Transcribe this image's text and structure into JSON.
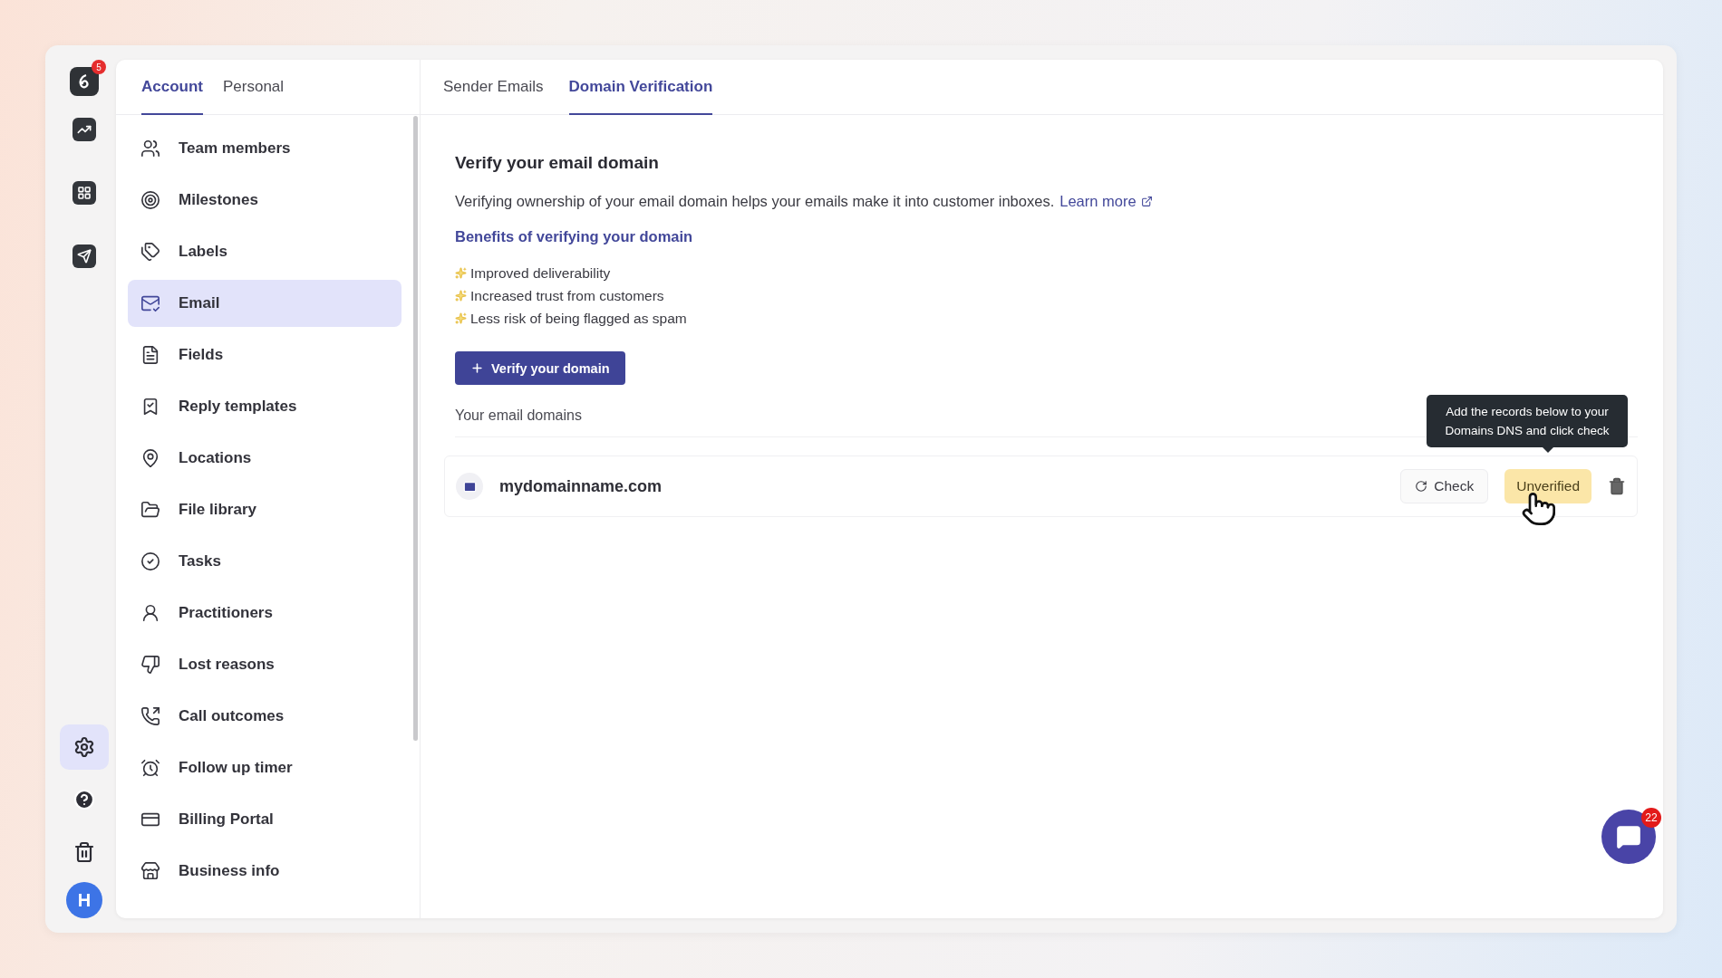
{
  "rail": {
    "logo_badge": "5",
    "top_items": [
      {
        "selected": false
      },
      {
        "selected": false
      },
      {
        "selected": false
      }
    ],
    "bottom_items": [
      {
        "selected": true
      },
      {
        "selected": false
      },
      {
        "selected": false
      }
    ],
    "avatar": "H"
  },
  "settings_tabs": [
    {
      "label": "Account",
      "selected": true
    },
    {
      "label": "Personal",
      "selected": false
    }
  ],
  "sidebar": {
    "items": [
      {
        "label": "Team members",
        "selected": false
      },
      {
        "label": "Milestones",
        "selected": false
      },
      {
        "label": "Labels",
        "selected": false
      },
      {
        "label": "Email",
        "selected": true
      },
      {
        "label": "Fields",
        "selected": false
      },
      {
        "label": "Reply templates",
        "selected": false
      },
      {
        "label": "Locations",
        "selected": false
      },
      {
        "label": "File library",
        "selected": false
      },
      {
        "label": "Tasks",
        "selected": false
      },
      {
        "label": "Practitioners",
        "selected": false
      },
      {
        "label": "Lost reasons",
        "selected": false
      },
      {
        "label": "Call outcomes",
        "selected": false
      },
      {
        "label": "Follow up timer",
        "selected": false
      },
      {
        "label": "Billing Portal",
        "selected": false
      },
      {
        "label": "Business info",
        "selected": false
      }
    ]
  },
  "content_tabs": [
    {
      "label": "Sender Emails",
      "selected": false
    },
    {
      "label": "Domain Verification",
      "selected": true
    }
  ],
  "main": {
    "title": "Verify your email domain",
    "description": "Verifying ownership of your email domain helps your emails make it into customer inboxes.",
    "learn_more": "Learn more",
    "benefits_title": "Benefits of verifying your domain",
    "benefits": [
      "Improved deliverability",
      "Increased trust from customers",
      "Less risk of being flagged as spam"
    ],
    "verify_button": "Verify your domain",
    "domains_label": "Your email domains",
    "domains": [
      {
        "name": "mydomainname.com",
        "check_label": "Check",
        "status": "Unverified",
        "verified": false,
        "tooltip": "Add the records below to your Domains DNS and click check"
      }
    ]
  },
  "chat": {
    "badge": "22"
  }
}
